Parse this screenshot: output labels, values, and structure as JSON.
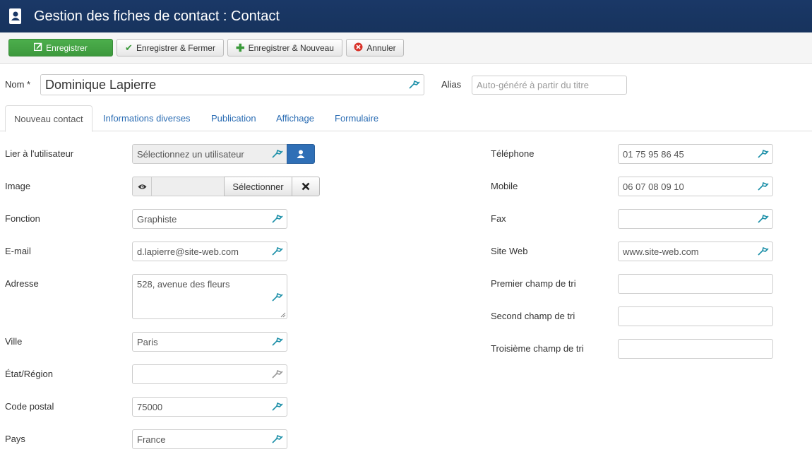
{
  "header": {
    "title": "Gestion des fiches de contact : Contact",
    "icon": "address-book-icon"
  },
  "toolbar": {
    "save": "Enregistrer",
    "save_close": "Enregistrer & Fermer",
    "save_new": "Enregistrer & Nouveau",
    "cancel": "Annuler"
  },
  "form_top": {
    "name_label": "Nom *",
    "name_value": "Dominique Lapierre",
    "alias_label": "Alias",
    "alias_placeholder": "Auto-généré à partir du titre"
  },
  "tabs": [
    "Nouveau contact",
    "Informations diverses",
    "Publication",
    "Affichage",
    "Formulaire"
  ],
  "left": {
    "user_label": "Lier à l'utilisateur",
    "user_value": "Sélectionnez un utilisateur",
    "image_label": "Image",
    "image_select": "Sélectionner",
    "fonction_label": "Fonction",
    "fonction_value": "Graphiste",
    "email_label": "E-mail",
    "email_value": "d.lapierre@site-web.com",
    "adresse_label": "Adresse",
    "adresse_value": "528, avenue des fleurs",
    "ville_label": "Ville",
    "ville_value": "Paris",
    "etat_label": "État/Région",
    "etat_value": "",
    "cp_label": "Code postal",
    "cp_value": "75000",
    "pays_label": "Pays",
    "pays_value": "France"
  },
  "right": {
    "tel_label": "Téléphone",
    "tel_value": "01 75 95 86 45",
    "mobile_label": "Mobile",
    "mobile_value": "06 07 08 09 10",
    "fax_label": "Fax",
    "fax_value": "",
    "web_label": "Site Web",
    "web_value": "www.site-web.com",
    "tri1_label": "Premier champ de tri",
    "tri2_label": "Second champ de tri",
    "tri3_label": "Troisième champ de tri"
  },
  "colors": {
    "header": "#1a3867",
    "save": "#46a546",
    "tab_link": "#2a6cb3",
    "user_btn": "#2f6fb6",
    "flag": "#1b8fa8"
  }
}
